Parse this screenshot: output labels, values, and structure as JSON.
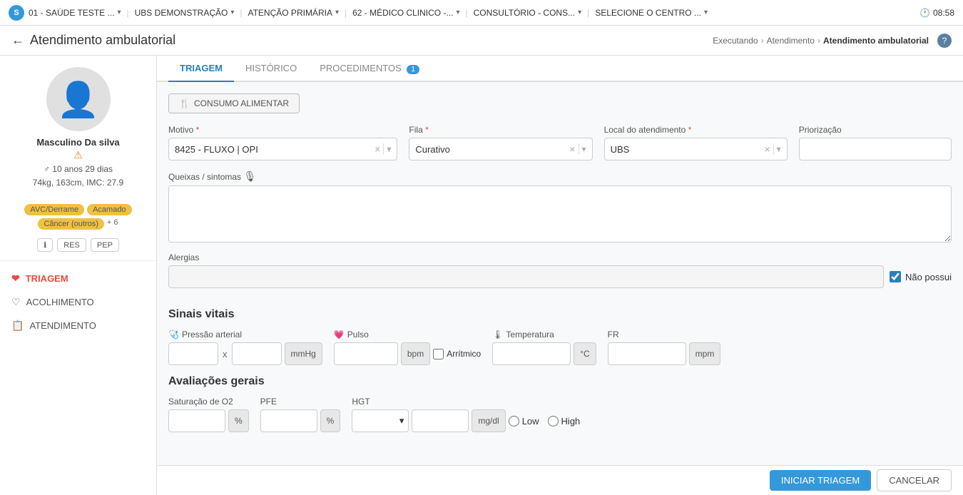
{
  "topnav": {
    "items": [
      {
        "id": "unit",
        "label": "01 - SAÚDE TESTE ..."
      },
      {
        "id": "ubs",
        "label": "UBS DEMONSTRAÇÃO"
      },
      {
        "id": "atencao",
        "label": "ATENÇÃO PRIMÁRIA"
      },
      {
        "id": "medico",
        "label": "62 - MÉDICO CLINICO -..."
      },
      {
        "id": "consultorio",
        "label": "CONSULTÓRIO - CONS..."
      },
      {
        "id": "centro",
        "label": "SELECIONE O CENTRO ..."
      }
    ],
    "time": "08:58",
    "clock_icon": "🕐"
  },
  "breadcrumb": {
    "back_label": "←",
    "page_title": "Atendimento ambulatorial",
    "path": [
      {
        "label": "Executando"
      },
      {
        "label": "Atendimento"
      },
      {
        "label": "Atendimento ambulatorial"
      }
    ],
    "help": "?"
  },
  "patient": {
    "name": "Masculino Da silva",
    "warning": "⚠",
    "gender_icon": "♂",
    "age": "10 anos 29 dias",
    "measurements": "74kg, 163cm, IMC: 27.9",
    "tags": [
      "AVC/Derrame",
      "Acamado",
      "Câncer (outros)"
    ],
    "more_tags": "+ 6",
    "action_info": "ℹ",
    "action_res": "RES",
    "action_pep": "PEP"
  },
  "sidebar": {
    "items": [
      {
        "id": "triagem",
        "label": "TRIAGEM",
        "icon": "❤",
        "active": true
      },
      {
        "id": "acolhimento",
        "label": "ACOLHIMENTO",
        "icon": "♡"
      },
      {
        "id": "atendimento",
        "label": "ATENDIMENTO",
        "icon": "📋"
      }
    ]
  },
  "tabs": [
    {
      "id": "triagem",
      "label": "TRIAGEM",
      "active": true,
      "badge": null
    },
    {
      "id": "historico",
      "label": "HISTÓRICO",
      "active": false,
      "badge": null
    },
    {
      "id": "procedimentos",
      "label": "PROCEDIMENTOS",
      "active": false,
      "badge": "1"
    }
  ],
  "form": {
    "consumo_btn": "CONSUMO ALIMENTAR",
    "consumo_icon": "🍴",
    "motivo_label": "Motivo",
    "motivo_value": "8425 - FLUXO | OPI",
    "fila_label": "Fila",
    "fila_value": "Curativo",
    "local_label": "Local do atendimento",
    "local_value": "UBS",
    "priorizacao_label": "Priorização",
    "queixas_label": "Queixas / sintomas",
    "alergias_label": "Alergias",
    "nao_possui_label": "Não possui",
    "sinais_vitais": {
      "title": "Sinais vitais",
      "pressao_label": "Pressão arterial",
      "pressao_icon": "🩺",
      "mmhg": "mmHg",
      "pulso_label": "Pulso",
      "pulso_icon": "💗",
      "bpm": "bpm",
      "arritmico_label": "Arrítmico",
      "temperatura_label": "Temperatura",
      "temperatura_icon": "🌡",
      "celsius": "°C",
      "fr_label": "FR",
      "mpm": "mpm"
    },
    "avaliacoes": {
      "title": "Avaliações gerais",
      "saturacao_label": "Saturação de O2",
      "percent": "%",
      "pfe_label": "PFE",
      "hgt_label": "HGT",
      "mgdl": "mg/dl",
      "low_label": "Low",
      "high_label": "High"
    }
  },
  "footer": {
    "save_label": "INICIAR TRIAGEM",
    "cancel_label": "CANCELAR"
  }
}
